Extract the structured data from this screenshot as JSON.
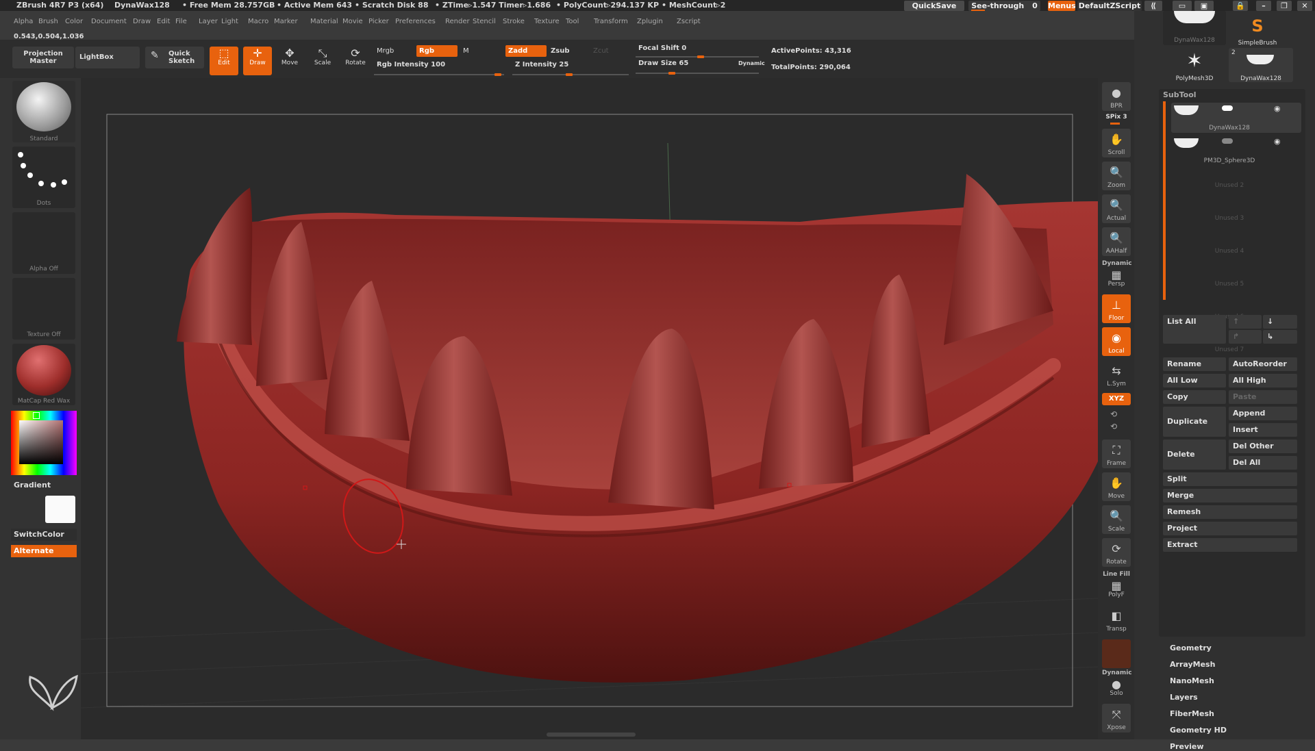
{
  "titlebar": {
    "app": "ZBrush 4R7 P3 (x64)",
    "tool": "DynaWax128",
    "free_mem": "• Free Mem 28.757GB",
    "active_mem": "• Active Mem 643",
    "scratch": "• Scratch Disk 88",
    "ztime": "• ZTime▹1.547 Timer▹1.686",
    "polycount": "• PolyCount▹294.137 KP",
    "meshcount": "• MeshCount▹2",
    "quicksave": "QuickSave",
    "seethrough": "See-through",
    "seethrough_val": "0",
    "menus": "Menus",
    "script": "DefaultZScript"
  },
  "menubar": [
    "Alpha",
    "Brush",
    "Color",
    "Document",
    "Draw",
    "Edit",
    "File",
    "Layer",
    "Light",
    "Macro",
    "Marker",
    "Material",
    "Movie",
    "Picker",
    "Preferences",
    "Render",
    "Stencil",
    "Stroke",
    "Texture",
    "Tool",
    "Transform",
    "Zplugin",
    "Zscript"
  ],
  "coords": "0.543,0.504,1.036",
  "topbar": {
    "projection_master": "Projection Master",
    "lightbox": "LightBox",
    "quick_sketch": "Quick Sketch",
    "edit": "Edit",
    "draw": "Draw",
    "move": "Move",
    "scale": "Scale",
    "rotate": "Rotate",
    "mrgb": "Mrgb",
    "rgb": "Rgb",
    "m": "M",
    "rgb_intensity": "Rgb Intensity 100",
    "zadd": "Zadd",
    "zsub": "Zsub",
    "zcut": "Zcut",
    "z_intensity": "Z Intensity 25",
    "focal_shift": "Focal Shift 0",
    "draw_size": "Draw Size 65",
    "dynamic": "Dynamic",
    "active_points": "ActivePoints: 43,316",
    "total_points": "TotalPoints: 290,064"
  },
  "leftpanel": {
    "brush": "Standard",
    "stroke": "Dots",
    "alpha": "Alpha Off",
    "texture": "Texture Off",
    "material": "MatCap Red Wax",
    "gradient": "Gradient",
    "switchcolor": "SwitchColor",
    "alternate": "Alternate"
  },
  "rightshelf": {
    "bpr": "BPR",
    "spix": "SPix 3",
    "scroll": "Scroll",
    "zoom": "Zoom",
    "actual": "Actual",
    "aahalf": "AAHalf",
    "dynamic": "Dynamic",
    "persp": "Persp",
    "floor": "Floor",
    "local": "Local",
    "lsym": "L.Sym",
    "xyz": "XYZ",
    "frame": "Frame",
    "move": "Move",
    "scale": "Scale",
    "rotate": "Rotate",
    "linefill": "Line Fill",
    "polyf": "PolyF",
    "transp": "Transp",
    "dynamic2": "Dynamic",
    "solo": "Solo",
    "xpose": "Xpose"
  },
  "toolpanel": {
    "brush1": "DynaWax128",
    "brush2": "SimpleBrush",
    "brush3": "PolyMesh3D",
    "brush4": "DynaWax128",
    "brush4_count": "2"
  },
  "subtool": {
    "title": "SubTool",
    "items": [
      {
        "name": "DynaWax128"
      },
      {
        "name": "PM3D_Sphere3D"
      },
      {
        "name": "Unused 2"
      },
      {
        "name": "Unused 3"
      },
      {
        "name": "Unused 4"
      },
      {
        "name": "Unused 5"
      },
      {
        "name": "Unused 6"
      },
      {
        "name": "Unused 7"
      }
    ],
    "list_all": "List All",
    "rename": "Rename",
    "autoreorder": "AutoReorder",
    "all_low": "All Low",
    "all_high": "All High",
    "copy": "Copy",
    "paste": "Paste",
    "duplicate": "Duplicate",
    "append": "Append",
    "insert": "Insert",
    "delete": "Delete",
    "del_other": "Del Other",
    "del_all": "Del All",
    "split": "Split",
    "merge": "Merge",
    "remesh": "Remesh",
    "project": "Project",
    "extract": "Extract"
  },
  "sections": [
    "Geometry",
    "ArrayMesh",
    "NanoMesh",
    "Layers",
    "FiberMesh",
    "Geometry HD",
    "Preview"
  ],
  "colors": {
    "accent": "#e8620e",
    "wax_red": "#9e2e2b"
  }
}
